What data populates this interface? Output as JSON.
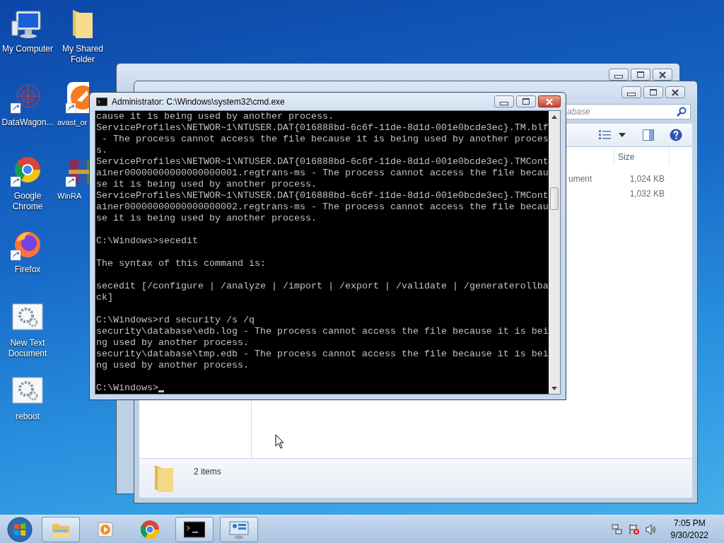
{
  "desktop": {
    "columns": [
      [
        {
          "label": "My Computer",
          "kind": "computer",
          "shortcut": false,
          "partly_hidden": false
        },
        {
          "label": "DataWagon...",
          "kind": "network",
          "shortcut": true,
          "partly_hidden": false
        },
        {
          "label": "Google Chrome",
          "kind": "chrome",
          "shortcut": true,
          "partly_hidden": false
        },
        {
          "label": "Firefox",
          "kind": "firefox",
          "shortcut": true,
          "partly_hidden": false
        },
        {
          "label": "New Text Document",
          "kind": "gears",
          "shortcut": false,
          "partly_hidden": false
        },
        {
          "label": "reboot",
          "kind": "gears",
          "shortcut": false,
          "partly_hidden": false
        }
      ],
      [
        {
          "label": "My Shared Folder",
          "kind": "folder",
          "shortcut": false,
          "partly_hidden": false
        },
        {
          "label": "avast_or",
          "kind": "avast",
          "shortcut": true,
          "partly_hidden": true
        },
        {
          "label": "WinRA",
          "kind": "winrar",
          "shortcut": true,
          "partly_hidden": true
        }
      ]
    ]
  },
  "explorer": {
    "search": {
      "placeholder": "abase"
    },
    "columns": [
      {
        "label": "Size"
      }
    ],
    "rows": [
      {
        "type": "ument",
        "size": "1,024 KB"
      },
      {
        "size": "1,032 KB"
      }
    ],
    "status": "2 items"
  },
  "console": {
    "title": "Administrator: C:\\Windows\\system32\\cmd.exe",
    "blocks": [
      {
        "lines": [
          "cause it is being used by another process.",
          "ServiceProfiles\\NETWOR~1\\NTUSER.DAT{016888bd-6c6f-11de-8d1d-001e0bcde3ec}.TM.blf",
          " - The process cannot access the file because it is being used by another proces",
          "s.",
          "ServiceProfiles\\NETWOR~1\\NTUSER.DAT{016888bd-6c6f-11de-8d1d-001e0bcde3ec}.TMCont",
          "ainer00000000000000000001.regtrans-ms - The process cannot access the file becau",
          "se it is being used by another process.",
          "ServiceProfiles\\NETWOR~1\\NTUSER.DAT{016888bd-6c6f-11de-8d1d-001e0bcde3ec}.TMCont",
          "ainer00000000000000000002.regtrans-ms - The process cannot access the file becau",
          "se it is being used by another process."
        ]
      },
      {
        "lines": [
          "C:\\Windows>secedit"
        ]
      },
      {
        "lines": [
          "The syntax of this command is:"
        ]
      },
      {
        "lines": [
          "secedit [/configure | /analyze | /import | /export | /validate | /generaterollba",
          "ck]"
        ]
      },
      {
        "lines": [
          "C:\\Windows>rd security /s /q",
          "security\\database\\edb.log - The process cannot access the file because it is bei",
          "ng used by another process.",
          "security\\database\\tmp.edb - The process cannot access the file because it is bei",
          "ng used by another process."
        ]
      },
      {
        "lines": [
          "C:\\Windows>"
        ],
        "cursor": true
      }
    ]
  },
  "taskbar": {
    "items": [
      {
        "kind": "explorer",
        "running": true
      },
      {
        "kind": "media",
        "running": false
      },
      {
        "kind": "chrome",
        "running": false
      },
      {
        "kind": "console",
        "running": true
      },
      {
        "kind": "panel",
        "running": true
      }
    ],
    "clock": {
      "time": "7:05 PM",
      "date": "9/30/2022"
    }
  }
}
